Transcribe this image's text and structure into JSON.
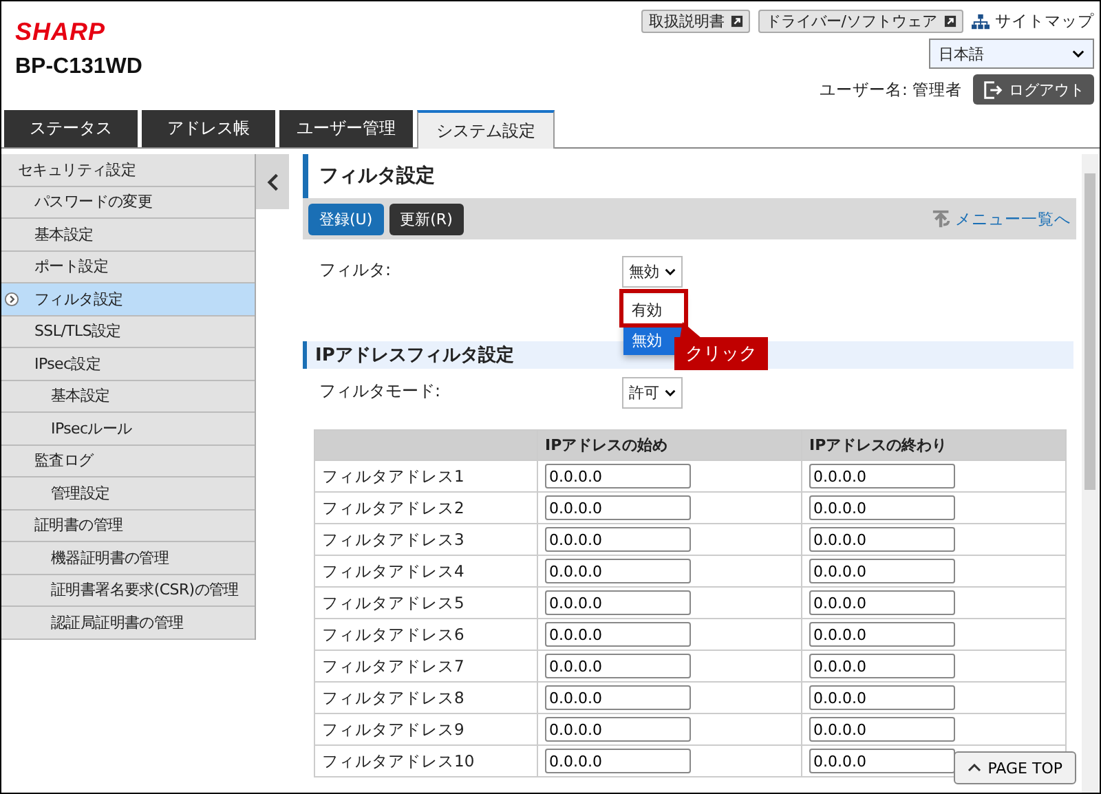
{
  "header": {
    "logo": "SHARP",
    "model": "BP-C131WD",
    "links": [
      {
        "label": "取扱説明書",
        "kind": "external"
      },
      {
        "label": "ドライバー/ソフトウェア",
        "kind": "external"
      },
      {
        "label": "サイトマップ",
        "kind": "sitemap"
      }
    ],
    "language": "日本語",
    "user_label": "ユーザー名:",
    "user_name": "管理者",
    "logout": "ログアウト"
  },
  "tabs": [
    {
      "label": "ステータス",
      "selected": false
    },
    {
      "label": "アドレス帳",
      "selected": false
    },
    {
      "label": "ユーザー管理",
      "selected": false
    },
    {
      "label": "システム設定",
      "selected": true
    }
  ],
  "sidebar": {
    "items": [
      {
        "label": "セキュリティ設定",
        "selected": false,
        "children": [
          {
            "label": "パスワードの変更",
            "selected": false
          },
          {
            "label": "基本設定",
            "selected": false
          },
          {
            "label": "ポート設定",
            "selected": false
          },
          {
            "label": "フィルタ設定",
            "selected": true
          },
          {
            "label": "SSL/TLS設定",
            "selected": false
          },
          {
            "label": "IPsec設定",
            "selected": false,
            "children": [
              {
                "label": "基本設定",
                "selected": false
              },
              {
                "label": "IPsecルール",
                "selected": false
              }
            ]
          },
          {
            "label": "監査ログ",
            "selected": false,
            "children": [
              {
                "label": "管理設定",
                "selected": false
              }
            ]
          },
          {
            "label": "証明書の管理",
            "selected": false,
            "children": [
              {
                "label": "機器証明書の管理",
                "selected": false
              },
              {
                "label": "証明書署名要求(CSR)の管理",
                "selected": false
              },
              {
                "label": "認証局証明書の管理",
                "selected": false
              }
            ]
          }
        ]
      }
    ]
  },
  "page": {
    "title": "フィルタ設定",
    "buttons": [
      {
        "label": "登録(U)",
        "kind": "primary"
      },
      {
        "label": "更新(R)",
        "kind": "secondary"
      }
    ],
    "menu_link": "メニュー一覧へ",
    "filter": {
      "label": "フィルタ:",
      "value": "無効",
      "options": [
        {
          "label": "有効",
          "selected": false
        },
        {
          "label": "無効",
          "selected": true
        }
      ]
    },
    "callout": "クリック",
    "section": "IPアドレスフィルタ設定",
    "mode": {
      "label": "フィルタモード:",
      "value": "許可"
    },
    "table": {
      "columns": [
        "IPアドレスの始め",
        "IPアドレスの終わり"
      ],
      "rows": [
        {
          "name": "フィルタアドレス1",
          "start": "0.0.0.0",
          "end": "0.0.0.0"
        },
        {
          "name": "フィルタアドレス2",
          "start": "0.0.0.0",
          "end": "0.0.0.0"
        },
        {
          "name": "フィルタアドレス3",
          "start": "0.0.0.0",
          "end": "0.0.0.0"
        },
        {
          "name": "フィルタアドレス4",
          "start": "0.0.0.0",
          "end": "0.0.0.0"
        },
        {
          "name": "フィルタアドレス5",
          "start": "0.0.0.0",
          "end": "0.0.0.0"
        },
        {
          "name": "フィルタアドレス6",
          "start": "0.0.0.0",
          "end": "0.0.0.0"
        },
        {
          "name": "フィルタアドレス7",
          "start": "0.0.0.0",
          "end": "0.0.0.0"
        },
        {
          "name": "フィルタアドレス8",
          "start": "0.0.0.0",
          "end": "0.0.0.0"
        },
        {
          "name": "フィルタアドレス9",
          "start": "0.0.0.0",
          "end": "0.0.0.0"
        },
        {
          "name": "フィルタアドレス10",
          "start": "0.0.0.0",
          "end": "0.0.0.0"
        }
      ]
    },
    "page_top": "PAGE TOP"
  }
}
